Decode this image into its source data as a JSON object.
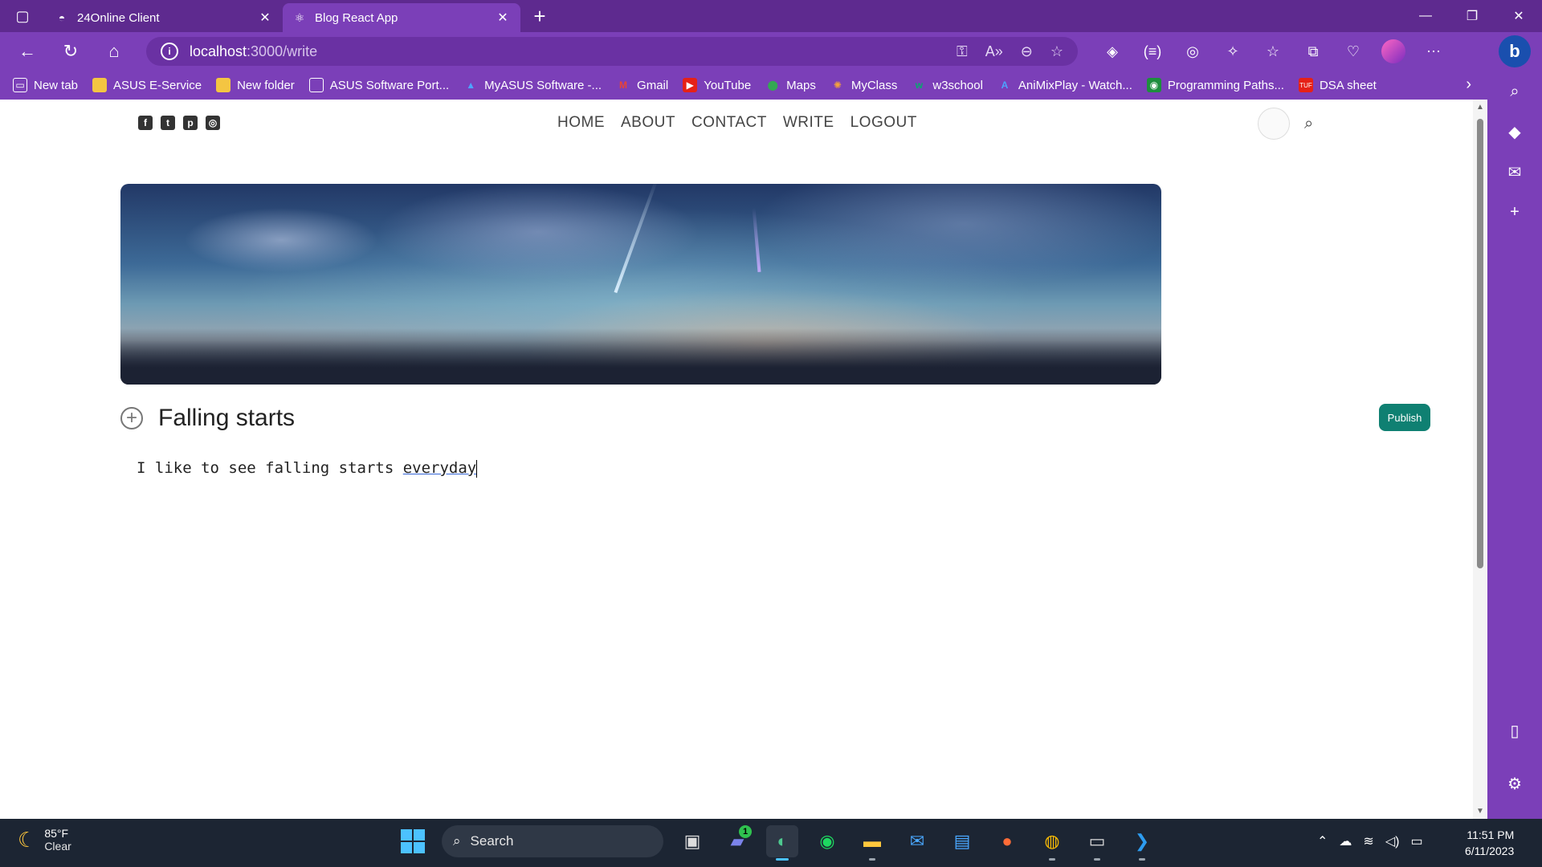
{
  "browser": {
    "tabs": [
      {
        "title": "24Online Client",
        "icon": "24online-icon",
        "active": false
      },
      {
        "title": "Blog React App",
        "icon": "react-icon",
        "active": true
      }
    ],
    "address": {
      "host": "localhost",
      "path": ":3000/write"
    },
    "bookmarks": [
      {
        "label": "New tab",
        "icon": "newtab-icon"
      },
      {
        "label": "ASUS E-Service",
        "icon": "folder-icon"
      },
      {
        "label": "New folder",
        "icon": "folder-icon"
      },
      {
        "label": "ASUS Software Port...",
        "icon": "page-icon"
      },
      {
        "label": "MyASUS Software -...",
        "icon": "myasus-icon"
      },
      {
        "label": "Gmail",
        "icon": "gmail-icon"
      },
      {
        "label": "YouTube",
        "icon": "youtube-icon"
      },
      {
        "label": "Maps",
        "icon": "maps-icon"
      },
      {
        "label": "MyClass",
        "icon": "myclass-icon"
      },
      {
        "label": "w3school",
        "icon": "w3school-icon"
      },
      {
        "label": "AniMixPlay - Watch...",
        "icon": "animixplay-icon"
      },
      {
        "label": "Programming Paths...",
        "icon": "programming-icon"
      },
      {
        "label": "DSA sheet",
        "icon": "dsa-icon"
      }
    ]
  },
  "site": {
    "nav": [
      "HOME",
      "ABOUT",
      "CONTACT",
      "WRITE",
      "LOGOUT"
    ],
    "social": [
      "facebook-icon",
      "twitter-icon",
      "pinterest-icon",
      "instagram-icon"
    ]
  },
  "write": {
    "title": "Falling starts",
    "body_text": "I like to see falling starts ",
    "body_misspelled": "everyday",
    "publish_label": "Publish"
  },
  "taskbar": {
    "weather_temp": "85°F",
    "weather_cond": "Clear",
    "search_label": "Search",
    "teams_badge": "1",
    "time": "11:51 PM",
    "date": "6/11/2023"
  },
  "colors": {
    "browser_frame": "#7b3fb8",
    "publish_button": "#0f8072",
    "taskbar": "#1c2533"
  }
}
